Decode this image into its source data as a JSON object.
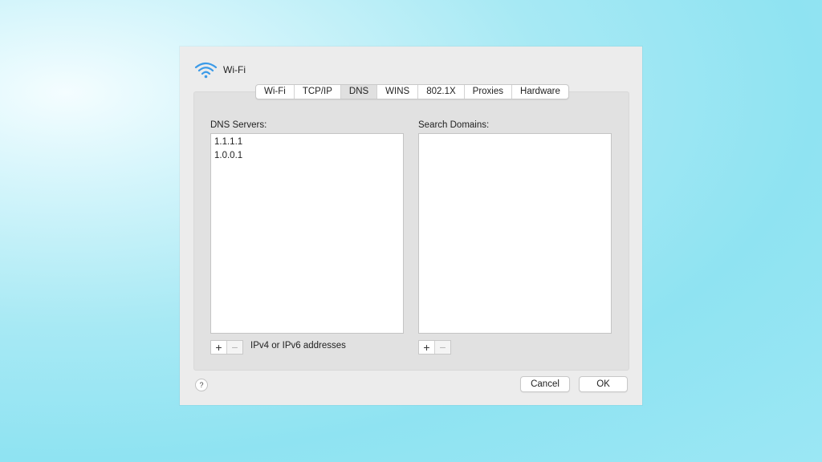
{
  "window": {
    "title": "Wi-Fi",
    "icon": "wifi-icon",
    "accent": "#3c9be8"
  },
  "tabs": [
    {
      "label": "Wi-Fi"
    },
    {
      "label": "TCP/IP"
    },
    {
      "label": "DNS",
      "selected": true
    },
    {
      "label": "WINS"
    },
    {
      "label": "802.1X"
    },
    {
      "label": "Proxies"
    },
    {
      "label": "Hardware"
    }
  ],
  "dns": {
    "servers_label": "DNS Servers:",
    "servers": [
      "1.1.1.1",
      "1.0.0.1"
    ],
    "servers_hint": "IPv4 or IPv6 addresses",
    "add_label": "+",
    "remove_label": "−"
  },
  "search": {
    "label": "Search Domains:",
    "domains": [],
    "add_label": "+",
    "remove_label": "−"
  },
  "footer": {
    "help_label": "?",
    "cancel_label": "Cancel",
    "ok_label": "OK"
  }
}
